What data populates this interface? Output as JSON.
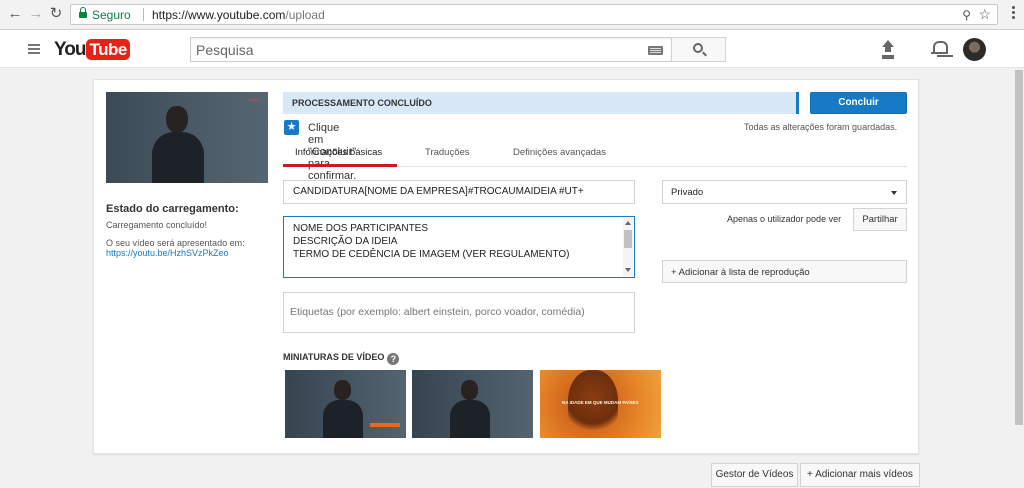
{
  "browser": {
    "secure_label": "Seguro",
    "url_base": "https://www.youtube.com",
    "url_path": "/upload"
  },
  "header": {
    "logo_you": "You",
    "logo_tube": "Tube",
    "search_placeholder": "Pesquisa"
  },
  "left": {
    "status_title": "Estado do carregamento:",
    "status_done": "Carregamento concluído!",
    "presented_at": "O seu vídeo será apresentado em:",
    "video_link": "https://youtu.be/HzhSVzPkZeo"
  },
  "processing": {
    "banner": "PROCESSAMENTO CONCLUÍDO",
    "confirm": "Clique em \"Concluir\" para confirmar.",
    "saved": "Todas as alterações foram guardadas.",
    "done_button": "Concluir"
  },
  "tabs": [
    {
      "label": "Informações básicas",
      "active": true
    },
    {
      "label": "Traduções",
      "active": false
    },
    {
      "label": "Definições avançadas",
      "active": false
    }
  ],
  "form": {
    "title_value": "CANDIDATURA[NOME DA EMPRESA]#TROCAUMAIDEIA #UT+",
    "description_lines": [
      "NOME DOS PARTICIPANTES",
      "DESCRIÇÃO DA IDEIA",
      "TERMO DE CEDÊNCIA DE IMAGEM (VER REGULAMENTO)"
    ],
    "tags_placeholder": "Etiquetas (por exemplo: albert einstein, porco voador, comédia)"
  },
  "privacy": {
    "selected": "Privado",
    "only_you": "Apenas o utilizador pode ver",
    "share_button": "Partilhar",
    "playlist_button": "+ Adicionar à lista de reprodução"
  },
  "thumbnails": {
    "title": "MINIATURAS DE VÍDEO",
    "orange_text": "NA IDADE EM QUE MUDAM PAÍSES"
  },
  "footer": {
    "manager_button": "Gestor de Vídeos",
    "add_more_button": "+ Adicionar mais vídeos"
  },
  "icons": {
    "back": "arrow-left-icon",
    "forward": "arrow-right-icon",
    "reload": "reload-icon",
    "lock": "lock-icon",
    "search": "search-icon",
    "upload": "upload-icon",
    "bell": "bell-icon",
    "help": "help-icon",
    "star": "star-icon"
  },
  "colors": {
    "accent_blue": "#167ac6",
    "brand_red": "#e62117",
    "secure_green": "#0b8043"
  }
}
